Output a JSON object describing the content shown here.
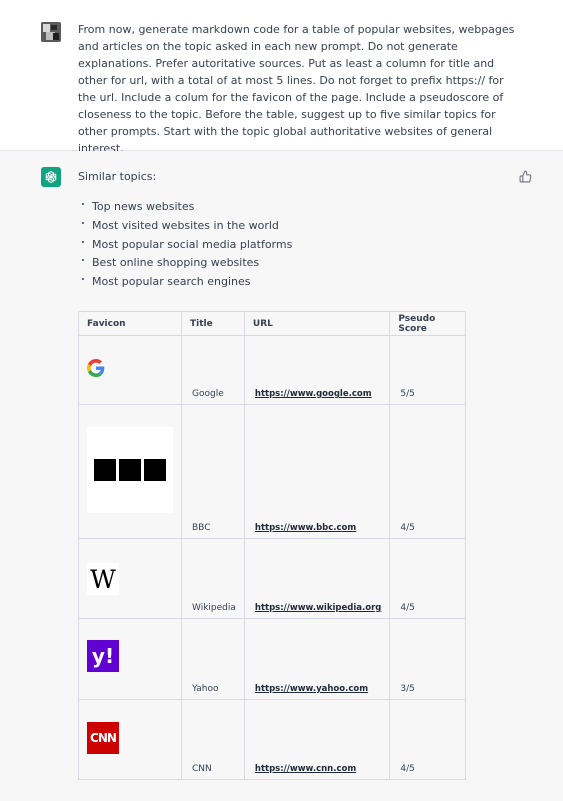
{
  "user_message": {
    "text": "From now, generate markdown code for a table of popular websites, webpages and articles on the topic asked in each new prompt. Do not generate explanations. Prefer autoritative sources. Put as least a column for title and other for url, with a total of at most 5 lines. Do not forget to prefix https:// for the url. Include a colum for the favicon of the page. Include a pseudoscore of closeness to the topic. Before the table, suggest up to five similar topics for other prompts. Start with the topic global authoritative websites of general interest."
  },
  "assistant_message": {
    "intro": "Similar topics:",
    "topics": [
      "Top news websites",
      "Most visited websites in the world",
      "Most popular social media platforms",
      "Best online shopping websites",
      "Most popular search engines"
    ],
    "table": {
      "headers": [
        "Favicon",
        "Title",
        "URL",
        "Pseudo Score"
      ],
      "rows": [
        {
          "favicon": "google-favicon",
          "title": "Google",
          "url": "https://www.google.com",
          "score": "5/5"
        },
        {
          "favicon": "bbc-favicon",
          "title": "BBC",
          "url": "https://www.bbc.com",
          "score": "4/5"
        },
        {
          "favicon": "wikipedia-favicon",
          "title": "Wikipedia",
          "url": "https://www.wikipedia.org",
          "score": "4/5"
        },
        {
          "favicon": "yahoo-favicon",
          "title": "Yahoo",
          "url": "https://www.yahoo.com",
          "score": "3/5"
        },
        {
          "favicon": "cnn-favicon",
          "title": "CNN",
          "url": "https://www.cnn.com",
          "score": "4/5"
        }
      ]
    },
    "favicon_text": {
      "wikipedia": "W",
      "yahoo": "y!",
      "cnn": "CNN"
    }
  },
  "colors": {
    "assistant_bg": "#f7f7f8",
    "gpt_brand": "#10a37f",
    "yahoo_purple": "#6001d2",
    "cnn_red": "#cc0000"
  }
}
